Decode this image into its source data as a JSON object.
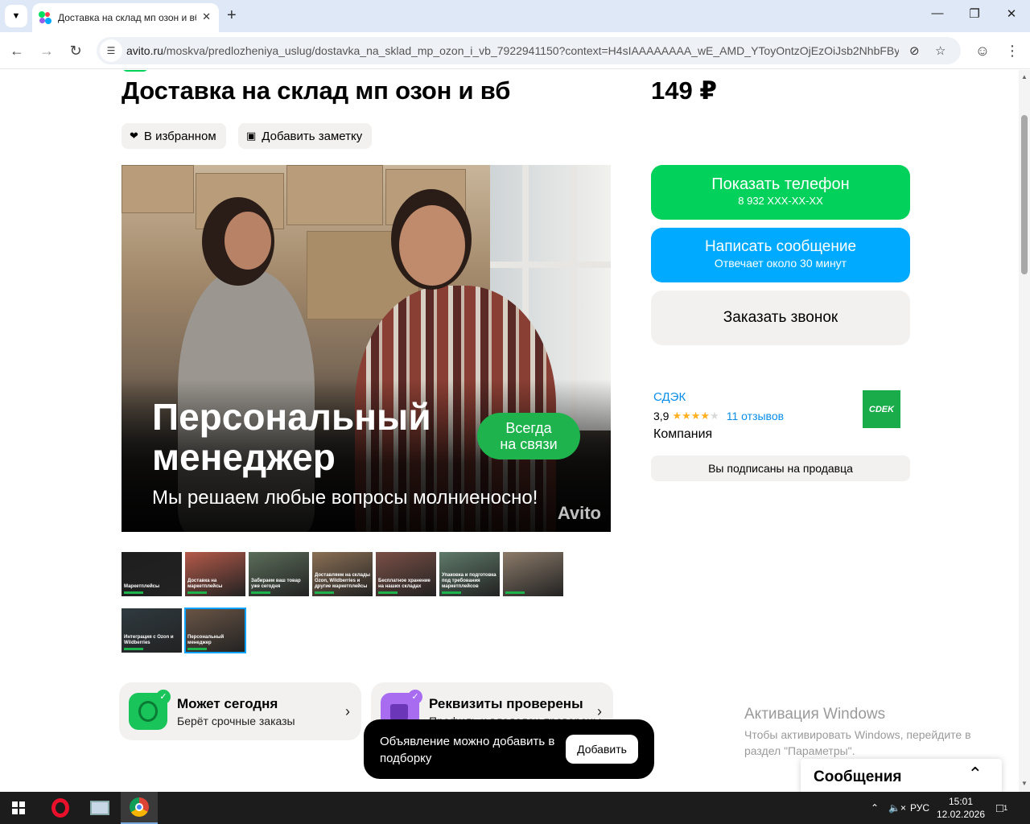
{
  "browser": {
    "tab_title": "Доставка на склад мп озон и вб",
    "url_domain": "avito.ru",
    "url_path": "/moskva/predlozheniya_uslug/dostavka_na_sklad_mp_ozon_i_vb_7922941150?context=H4sIAAAAAAAA_wE_AMD_YToyOntzOjEzOiJsb2NhbFByaW..."
  },
  "listing": {
    "title": "Доставка на склад мп озон и вб",
    "price": "149 ₽",
    "favorite_label": "В избранном",
    "note_label": "Добавить заметку"
  },
  "photo": {
    "headline_1": "Персональный",
    "headline_2": "менеджер",
    "subline": "Мы решаем любые вопросы молниеносно!",
    "badge_1": "Всегда",
    "badge_2": "на связи",
    "watermark": "Avito"
  },
  "thumbnails": [
    {
      "caption": "Маркетплейсы",
      "bg": "#1e1e1e"
    },
    {
      "caption": "Доставка на маркетплейсы",
      "bg": "#b45a4a"
    },
    {
      "caption": "Забираем ваш товар уже сегодня",
      "bg": "#5b6d5a"
    },
    {
      "caption": "Доставляем на склады Ozon, Wildberries и другие маркетплейсы",
      "bg": "#8a6f55"
    },
    {
      "caption": "Бесплатное хранение на наших складах",
      "bg": "#7a4f46"
    },
    {
      "caption": "Упаковка и подготовка под требования маркетплейсов",
      "bg": "#5f7a6a"
    },
    {
      "caption": "",
      "bg": "#8c7b6a"
    },
    {
      "caption": "Интеграция с Ozon и Wildberries",
      "bg": "#2f3a40"
    },
    {
      "caption": "Персональный менеджер",
      "bg": "#6a5546"
    }
  ],
  "cards": [
    {
      "title": "Может сегодня",
      "subtitle": "Берёт срочные заказы"
    },
    {
      "title": "Реквизиты проверены",
      "subtitle": "Профиль и владелец проверены"
    }
  ],
  "actions": {
    "show_phone": "Показать телефон",
    "phone": "8 932 XXX-XX-XX",
    "write_message": "Написать сообщение",
    "reply_time": "Отвечает около 30 минут",
    "order_call": "Заказать звонок"
  },
  "seller": {
    "name": "СДЭК",
    "rating": "3,9",
    "rating_value": 3.9,
    "reviews": "11 отзывов",
    "type": "Компания",
    "logo_text": "CDEK",
    "subscribed": "Вы подписаны на продавца"
  },
  "toast": {
    "text": "Объявление можно добавить в подборку",
    "button": "Добавить"
  },
  "messages": {
    "title": "Сообщения"
  },
  "windows": {
    "activation_title": "Активация Windows",
    "activation_text_1": "Чтобы активировать Windows, перейдите в",
    "activation_text_2": "раздел \"Параметры\".",
    "lang": "РУС",
    "time": "15:01",
    "date": "12.02.2026",
    "notif_count": "1"
  },
  "colors": {
    "green": "#02d15c",
    "blue": "#00aaff",
    "link": "#0a8ee8",
    "chip_bg": "#f2f1f0"
  }
}
